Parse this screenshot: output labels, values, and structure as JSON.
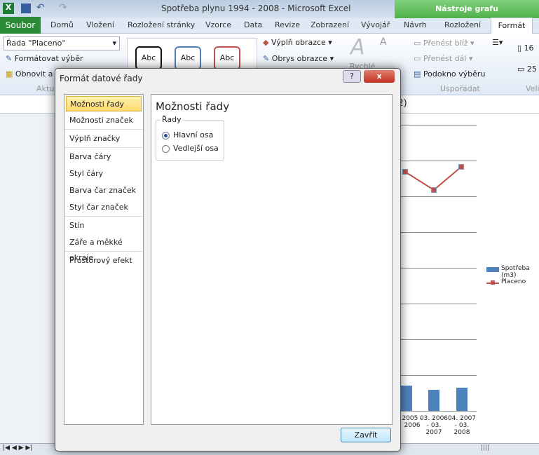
{
  "window": {
    "title": "Spotřeba plynu 1994 - 2008  -  Microsoft Excel",
    "context_header": "Nástroje grafu"
  },
  "tabs": [
    "Soubor",
    "Domů",
    "Vložení",
    "Rozložení stránky",
    "Vzorce",
    "Data",
    "Revize",
    "Zobrazení",
    "Vývojář",
    "Návrh",
    "Rozložení",
    "Formát"
  ],
  "ribbon": {
    "selection_dropdown": "Řada \"Placeno\"",
    "format_selection": "Formátovat výběr",
    "reset": "Obnovit a",
    "group_current": "Aktu",
    "style_samples": [
      "Abc",
      "Abc",
      "Abc"
    ],
    "shape_fill": "Výplň obrazce",
    "shape_outline": "Obrys obrazce",
    "quick": "Rychlé",
    "bring_forward": "Přenést blíž",
    "send_backward": "Přenést dál",
    "selection_pane": "Podokno výběru",
    "group_arrange": "Uspořádat",
    "group_size": "Veli",
    "size_h": "16",
    "size_w": "25"
  },
  "formula_fragment": ";2)",
  "dialog": {
    "title": "Formát datové řady",
    "help": "?",
    "close_x": "x",
    "categories": [
      "Možnosti řady",
      "Možnosti značek",
      "Výplň značky",
      "Barva čáry",
      "Styl čáry",
      "Barva čar značek",
      "Styl čar značek",
      "Stín",
      "Záře a měkké okraje",
      "Prostorový efekt"
    ],
    "selected_category": "Možnosti řady",
    "pane_title": "Možnosti řady",
    "group_label": "Řady",
    "options": [
      {
        "label": "Hlavní osa",
        "checked": true
      },
      {
        "label": "Vedlejší osa",
        "checked": false
      }
    ],
    "close_button": "Zavřít"
  },
  "chart_data": {
    "type": "bar",
    "categories": [
      "2005 - 2006",
      "03. 2006 - 03. 2007",
      "04. 2007 - 03. 2008"
    ],
    "series": [
      {
        "name": "Spotřeba (m3)",
        "type": "bar",
        "color": "#4f81bd"
      },
      {
        "name": "Placeno",
        "type": "line",
        "color": "#c0504d"
      }
    ],
    "legend": "right"
  }
}
